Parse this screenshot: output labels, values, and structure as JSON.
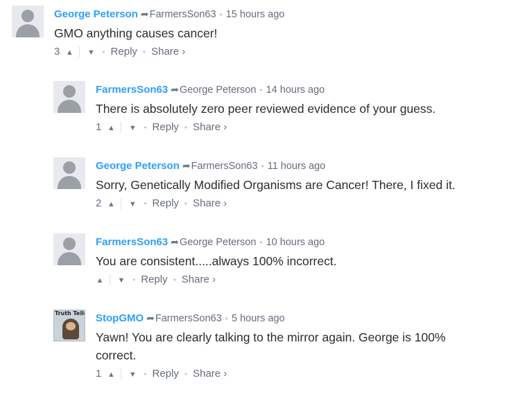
{
  "comments": [
    {
      "author": "George Peterson",
      "reply_to": "FarmersSon63",
      "time": "15 hours ago",
      "text": "GMO anything causes cancer!",
      "votes": "3",
      "reply_label": "Reply",
      "share_label": "Share ›",
      "avatar": "default-avatar"
    },
    {
      "author": "FarmersSon63",
      "reply_to": "George Peterson",
      "time": "14 hours ago",
      "text": "There is absolutely zero peer reviewed evidence of your guess.",
      "votes": "1",
      "reply_label": "Reply",
      "share_label": "Share ›",
      "avatar": "default-avatar"
    },
    {
      "author": "George Peterson",
      "reply_to": "FarmersSon63",
      "time": "11 hours ago",
      "text": "Sorry, Genetically Modified Organisms are Cancer! There, I fixed it.",
      "votes": "2",
      "reply_label": "Reply",
      "share_label": "Share ›",
      "avatar": "default-avatar"
    },
    {
      "author": "FarmersSon63",
      "reply_to": "George Peterson",
      "time": "10 hours ago",
      "text": "You are consistent.....always 100% incorrect.",
      "votes": "",
      "reply_label": "Reply",
      "share_label": "Share ›",
      "avatar": "default-avatar"
    },
    {
      "author": "StopGMO",
      "reply_to": "FarmersSon63",
      "time": "5 hours ago",
      "text_line1": "Yawn! You are clearly talking to the mirror again. George is 100%",
      "text_line2": "correct.",
      "votes": "1",
      "reply_label": "Reply",
      "share_label": "Share ›",
      "avatar": "photo-avatar",
      "avatar_caption": "Truth Teller"
    }
  ],
  "icons": {
    "upvote": "chevron-up-icon",
    "downvote": "chevron-down-icon",
    "reply_arrow": "share-arrow-icon"
  },
  "colors": {
    "author": "#2e9fff",
    "meta": "#656c7a",
    "text": "#2a2e2e",
    "avatar": "#9aa0a6"
  }
}
